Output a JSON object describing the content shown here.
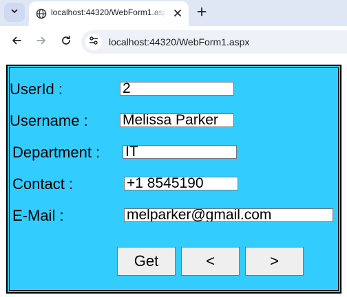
{
  "browser": {
    "tab": {
      "title": "localhost:44320/WebForm1.aspx",
      "favicon": "globe-icon"
    },
    "address_bar": {
      "url": "localhost:44320/WebForm1.aspx"
    },
    "icons": {
      "tab_menu": "chevron-down-icon",
      "close_tab": "close-icon",
      "new_tab": "plus-icon",
      "back": "arrow-left-icon",
      "forward": "arrow-right-icon",
      "reload": "reload-icon",
      "site_info": "tune-icon"
    }
  },
  "form": {
    "background_color": "#33ccff",
    "fields": {
      "userid": {
        "label": "UserId :",
        "value": "2"
      },
      "username": {
        "label": "Username :",
        "value": "Melissa Parker"
      },
      "department": {
        "label": "Department :",
        "value": "IT"
      },
      "contact": {
        "label": "Contact :",
        "value": "+1 8545190"
      },
      "email": {
        "label": "E-Mail :",
        "value": "melparker@gmail.com"
      }
    },
    "buttons": {
      "get": "Get",
      "previous": "<",
      "next": ">"
    }
  }
}
